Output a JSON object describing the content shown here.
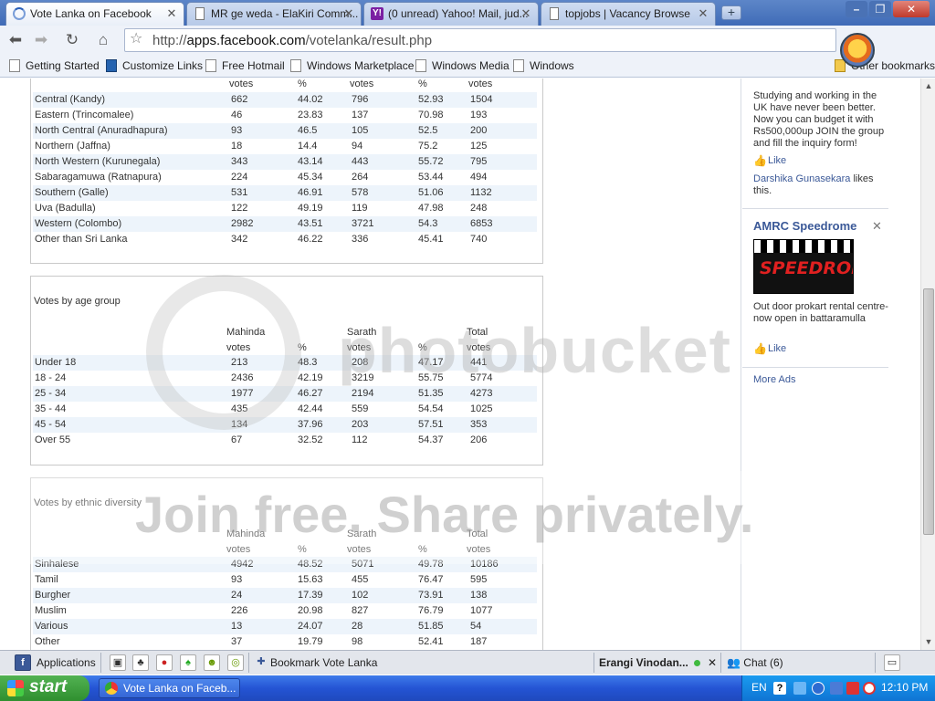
{
  "browser": {
    "tabs": [
      {
        "title": "Vote Lanka on Facebook",
        "active": true
      },
      {
        "title": "MR ge weda - ElaKiri Comm...",
        "active": false
      },
      {
        "title": "(0 unread) Yahoo! Mail, jud...",
        "active": false
      },
      {
        "title": "topjobs | Vacancy Browse",
        "active": false
      }
    ],
    "url_prefix": "http://",
    "url_host": "apps.facebook.com",
    "url_path": "/votelanka/result.php",
    "bookmarks": [
      "Getting Started",
      "Customize Links",
      "Free Hotmail",
      "Windows Marketplace",
      "Windows Media",
      "Windows"
    ],
    "other_bookmarks": "Other bookmarks"
  },
  "tables": {
    "province": {
      "header_cells": [
        "votes",
        "%",
        "votes",
        "%",
        "votes"
      ],
      "rows": [
        [
          "Central (Kandy)",
          "662",
          "44.02",
          "796",
          "52.93",
          "1504"
        ],
        [
          "Eastern (Trincomalee)",
          "46",
          "23.83",
          "137",
          "70.98",
          "193"
        ],
        [
          "North Central (Anuradhapura)",
          "93",
          "46.5",
          "105",
          "52.5",
          "200"
        ],
        [
          "Northern (Jaffna)",
          "18",
          "14.4",
          "94",
          "75.2",
          "125"
        ],
        [
          "North Western (Kurunegala)",
          "343",
          "43.14",
          "443",
          "55.72",
          "795"
        ],
        [
          "Sabaragamuwa (Ratnapura)",
          "224",
          "45.34",
          "264",
          "53.44",
          "494"
        ],
        [
          "Southern (Galle)",
          "531",
          "46.91",
          "578",
          "51.06",
          "1132"
        ],
        [
          "Uva (Badulla)",
          "122",
          "49.19",
          "119",
          "47.98",
          "248"
        ],
        [
          "Western (Colombo)",
          "2982",
          "43.51",
          "3721",
          "54.3",
          "6853"
        ],
        [
          "Other than Sri Lanka",
          "342",
          "46.22",
          "336",
          "45.41",
          "740"
        ]
      ]
    },
    "age": {
      "title": "Votes by age group",
      "header_top": [
        "Mahinda",
        "Sarath",
        "Total"
      ],
      "header_cells": [
        "votes",
        "%",
        "votes",
        "%",
        "votes"
      ],
      "rows": [
        [
          "Under 18",
          "213",
          "48.3",
          "208",
          "47.17",
          "441"
        ],
        [
          "18 - 24",
          "2436",
          "42.19",
          "3219",
          "55.75",
          "5774"
        ],
        [
          "25 - 34",
          "1977",
          "46.27",
          "2194",
          "51.35",
          "4273"
        ],
        [
          "35 - 44",
          "435",
          "42.44",
          "559",
          "54.54",
          "1025"
        ],
        [
          "45 - 54",
          "134",
          "37.96",
          "203",
          "57.51",
          "353"
        ],
        [
          "Over 55",
          "67",
          "32.52",
          "112",
          "54.37",
          "206"
        ]
      ]
    },
    "ethnic": {
      "title": "Votes by ethnic diversity",
      "header_top": [
        "Mahinda",
        "Sarath",
        "Total"
      ],
      "header_cells": [
        "votes",
        "%",
        "votes",
        "%",
        "votes"
      ],
      "rows": [
        [
          "Sinhalese",
          "4942",
          "48.52",
          "5071",
          "49.78",
          "10186"
        ],
        [
          "Tamil",
          "93",
          "15.63",
          "455",
          "76.47",
          "595"
        ],
        [
          "Burgher",
          "24",
          "17.39",
          "102",
          "73.91",
          "138"
        ],
        [
          "Muslim",
          "226",
          "20.98",
          "827",
          "76.79",
          "1077"
        ],
        [
          "Various",
          "13",
          "24.07",
          "28",
          "51.85",
          "54"
        ],
        [
          "Other",
          "37",
          "19.79",
          "98",
          "52.41",
          "187"
        ]
      ]
    }
  },
  "sidebar": {
    "ad1_text": "Studying and working in the UK have never been better. Now you can budget it with Rs500,000up JOIN the group and fill the inquiry form!",
    "like_label": "Like",
    "ad1_liker": "Darshika Gunasekara",
    "ad1_liker_suffix": " likes this.",
    "ad2_title": "AMRC Speedrome",
    "ad2_image_text": "SPEEDROME",
    "ad2_text": "Out door prokart rental centre- now open in battaramulla",
    "more_ads": "More Ads"
  },
  "watermark": {
    "line1": "photobucket",
    "line2": "Join free. Share privately."
  },
  "fb_bar": {
    "applications": "Applications",
    "bookmark_label": "Bookmark Vote Lanka",
    "friend_name": "Erangi Vinodan...",
    "chat_label": "Chat (6)"
  },
  "taskbar": {
    "start": "start",
    "task_title": "Vote Lanka on Faceb...",
    "lang": "EN",
    "clock": "12:10 PM"
  }
}
